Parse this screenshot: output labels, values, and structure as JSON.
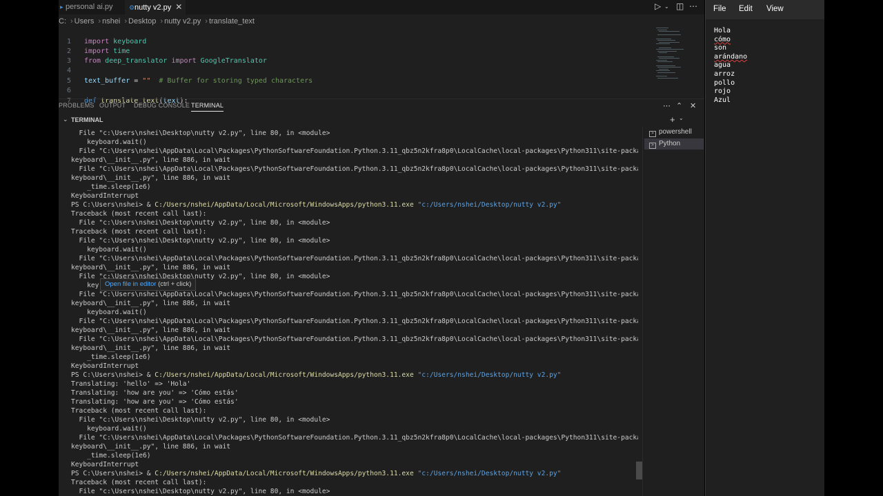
{
  "vscode": {
    "tabs": [
      {
        "label": "personal ai.py",
        "active": false
      },
      {
        "label": "nutty v2.py",
        "active": true
      }
    ],
    "breadcrumb": [
      "C:",
      "Users",
      "nshei",
      "Desktop",
      "nutty v2.py",
      "translate_text"
    ],
    "editor_lines": [
      {
        "n": "1",
        "code": "import keyboard"
      },
      {
        "n": "2",
        "code": "import time"
      },
      {
        "n": "3",
        "code": "from deep_translator import GoogleTranslator"
      },
      {
        "n": "4",
        "code": ""
      },
      {
        "n": "5",
        "code": "text_buffer = \"\"  # Buffer for storing typed characters"
      },
      {
        "n": "6",
        "code": ""
      },
      {
        "n": "7",
        "code": "def translate_text(text):"
      }
    ],
    "panel_tabs": [
      "PROBLEMS",
      "OUTPUT",
      "DEBUG CONSOLE",
      "TERMINAL"
    ],
    "terminal_header": "TERMINAL",
    "terminal_list": [
      "powershell",
      "Python"
    ],
    "tooltip": {
      "link": "Open file in editor",
      "hint": "(ctrl + click)"
    },
    "terminal_lines": [
      "  File \"c:\\Users\\nshei\\Desktop\\nutty v2.py\", line 80, in <module>",
      "    keyboard.wait()",
      "  File \"C:\\Users\\nshei\\AppData\\Local\\Packages\\PythonSoftwareFoundation.Python.3.11_qbz5n2kfra8p0\\LocalCache\\local-packages\\Python311\\site-packages\\",
      "keyboard\\__init__.py\", line 886, in wait",
      "  File \"C:\\Users\\nshei\\AppData\\Local\\Packages\\PythonSoftwareFoundation.Python.3.11_qbz5n2kfra8p0\\LocalCache\\local-packages\\Python311\\site-packages\\",
      "keyboard\\__init__.py\", line 886, in wait",
      "    _time.sleep(1e6)",
      "KeyboardInterrupt",
      "PS C:\\Users\\nshei> & C:/Users/nshei/AppData/Local/Microsoft/WindowsApps/python3.11.exe \"c:/Users/nshei/Desktop/nutty v2.py\"",
      "Traceback (most recent call last):",
      "  File \"c:\\Users\\nshei\\Desktop\\nutty v2.py\", line 80, in <module>",
      "Traceback (most recent call last):",
      "  File \"c:\\Users\\nshei\\Desktop\\nutty v2.py\", line 80, in <module>",
      "    keyboard.wait()",
      "  File \"C:\\Users\\nshei\\AppData\\Local\\Packages\\PythonSoftwareFoundation.Python.3.11_qbz5n2kfra8p0\\LocalCache\\local-packages\\Python311\\site-packages\\",
      "keyboard\\__init__.py\", line 886, in wait",
      "  File \"c:\\Users\\nshei\\Desktop\\nutty v2.py\", line 80, in <module>",
      "    key",
      "  File \"C:\\Users\\nshei\\AppData\\Local\\Packages\\PythonSoftwareFoundation.Python.3.11_qbz5n2kfra8p0\\LocalCache\\local-packages\\Python311\\site-packages\\",
      "keyboard\\__init__.py\", line 886, in wait",
      "    keyboard.wait()",
      "  File \"C:\\Users\\nshei\\AppData\\Local\\Packages\\PythonSoftwareFoundation.Python.3.11_qbz5n2kfra8p0\\LocalCache\\local-packages\\Python311\\site-packages\\",
      "keyboard\\__init__.py\", line 886, in wait",
      "  File \"C:\\Users\\nshei\\AppData\\Local\\Packages\\PythonSoftwareFoundation.Python.3.11_qbz5n2kfra8p0\\LocalCache\\local-packages\\Python311\\site-packages\\",
      "keyboard\\__init__.py\", line 886, in wait",
      "    _time.sleep(1e6)",
      "KeyboardInterrupt",
      "PS C:\\Users\\nshei> & C:/Users/nshei/AppData/Local/Microsoft/WindowsApps/python3.11.exe \"c:/Users/nshei/Desktop/nutty v2.py\"",
      "Translating: 'hello' => 'Hola'",
      "Translating: 'how are you' => 'Cómo estás'",
      "Translating: 'how are you' => 'Cómo estás'",
      "Traceback (most recent call last):",
      "  File \"c:\\Users\\nshei\\Desktop\\nutty v2.py\", line 80, in <module>",
      "    keyboard.wait()",
      "  File \"C:\\Users\\nshei\\AppData\\Local\\Packages\\PythonSoftwareFoundation.Python.3.11_qbz5n2kfra8p0\\LocalCache\\local-packages\\Python311\\site-packages\\",
      "keyboard\\__init__.py\", line 886, in wait",
      "    _time.sleep(1e6)",
      "KeyboardInterrupt",
      "PS C:\\Users\\nshei> & C:/Users/nshei/AppData/Local/Microsoft/WindowsApps/python3.11.exe \"c:/Users/nshei/Desktop/nutty v2.py\"",
      "Traceback (most recent call last):",
      "  File \"c:\\Users\\nshei\\Desktop\\nutty v2.py\", line 80, in <module>"
    ]
  },
  "notepad": {
    "menu": [
      "File",
      "Edit",
      "View"
    ],
    "lines": [
      "Hola",
      "cómo",
      "son",
      "arándano",
      "agua",
      "arroz",
      "pollo",
      "rojo",
      "Azul"
    ]
  }
}
